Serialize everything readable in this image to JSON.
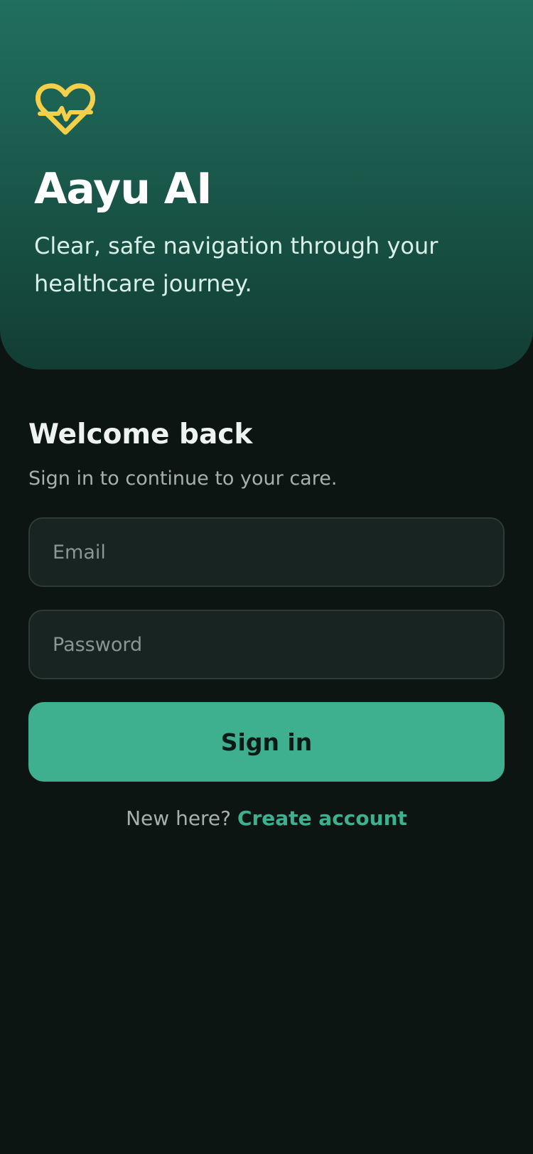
{
  "brand": {
    "icon": "heart-pulse-icon",
    "title": "Aayu AI",
    "tagline": "Clear, safe navigation through your healthcare journey."
  },
  "signin": {
    "heading": "Welcome back",
    "subtitle": "Sign in to continue to your care.",
    "email": {
      "value": "",
      "placeholder": "Email"
    },
    "password": {
      "value": "",
      "placeholder": "Password"
    },
    "button_label": "Sign in",
    "signup_prompt": "New here?",
    "signup_link": "Create account"
  },
  "colors": {
    "background": "#0d1513",
    "hero_top": "#216f5e",
    "hero_bottom": "#123d34",
    "accent": "#3eb08f",
    "brand_icon": "#f3cf4a",
    "field_background": "#172421"
  }
}
